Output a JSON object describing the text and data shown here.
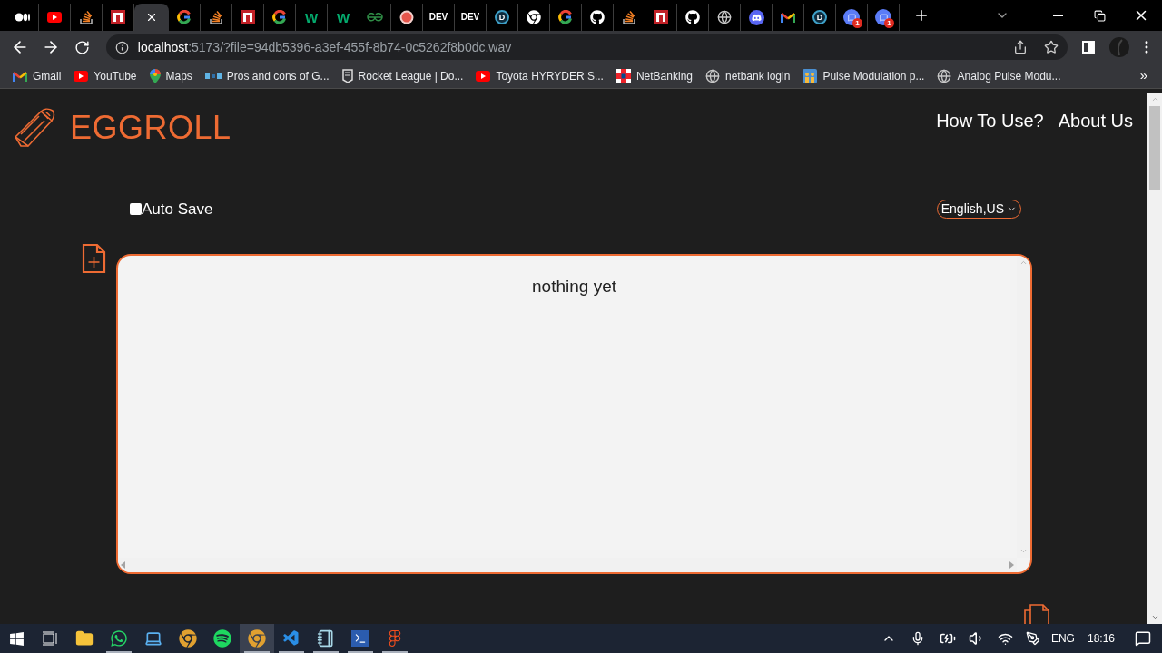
{
  "browser": {
    "tabs": [
      {
        "selected": false
      },
      {
        "selected": false
      },
      {
        "selected": false
      },
      {
        "selected": false
      },
      {
        "selected": true
      },
      {
        "selected": false
      },
      {
        "selected": false
      },
      {
        "selected": false
      },
      {
        "selected": false
      },
      {
        "label": "W",
        "selected": false
      },
      {
        "label": "W",
        "selected": false
      },
      {
        "selected": false
      },
      {
        "selected": false
      },
      {
        "label": "DEV",
        "selected": false
      },
      {
        "label": "DEV",
        "selected": false
      },
      {
        "label": "D",
        "selected": false
      },
      {
        "selected": false
      },
      {
        "selected": false
      },
      {
        "selected": false
      },
      {
        "selected": false
      },
      {
        "selected": false
      },
      {
        "selected": false
      },
      {
        "selected": false
      },
      {
        "selected": false
      },
      {
        "selected": false
      },
      {
        "label": "D",
        "selected": false
      },
      {
        "badge": "1",
        "selected": false
      },
      {
        "badge": "1",
        "selected": false
      }
    ],
    "address": {
      "host": "localhost",
      "rest": ":5173/?file=94db5396-a3ef-455f-8b74-0c5262f8b0dc.wav"
    },
    "bookmarks": [
      {
        "label": "Gmail"
      },
      {
        "label": "YouTube"
      },
      {
        "label": "Maps"
      },
      {
        "label": "Pros and cons of G..."
      },
      {
        "label": "Rocket League | Do..."
      },
      {
        "label": "Toyota HYRYDER S..."
      },
      {
        "label": "NetBanking"
      },
      {
        "label": "netbank login"
      },
      {
        "label": "Pulse Modulation p..."
      },
      {
        "label": "Analog Pulse Modu..."
      }
    ],
    "overflow": "»"
  },
  "page": {
    "logo": "EGGROLL",
    "nav": [
      "How To Use?",
      "About Us"
    ],
    "auto_save": {
      "label": "Auto Save",
      "checked": false
    },
    "language": "English,US",
    "editor": {
      "text": "nothing yet"
    }
  },
  "taskbar": {
    "apps": [
      {
        "running": false,
        "selected": false
      },
      {
        "running": true,
        "selected": false
      },
      {
        "running": false,
        "selected": false
      },
      {
        "running": false,
        "selected": false
      },
      {
        "running": false,
        "selected": false
      },
      {
        "running": true,
        "selected": true
      },
      {
        "running": true,
        "selected": false
      },
      {
        "running": true,
        "selected": false
      },
      {
        "running": true,
        "selected": false
      },
      {
        "running": true,
        "selected": false
      }
    ],
    "language": "ENG",
    "time": "18:16"
  }
}
